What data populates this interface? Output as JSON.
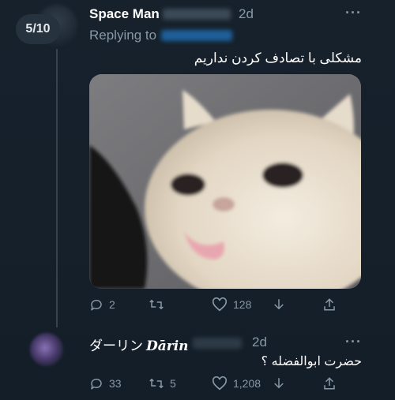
{
  "thread": {
    "page_indicator": "5/10",
    "tweet1": {
      "author_name": "Space Man",
      "time": "2d",
      "replying_to": "Replying to",
      "text": "مشکلی با تصادف کردن نداریم",
      "stats": {
        "replies": "2",
        "retweets": "",
        "likes": "128"
      }
    },
    "tweet2": {
      "author_name_jp": "ダーリン",
      "author_name_latin": "Dārin",
      "time": "2d",
      "text": "حضرت ابوالفضله ؟",
      "stats": {
        "replies": "33",
        "retweets": "5",
        "likes": "1,208"
      }
    },
    "more_menu": "···"
  },
  "icons": {
    "reply": "reply-icon",
    "retweet": "retweet-icon",
    "like": "heart-icon",
    "download": "download-icon",
    "share": "share-icon"
  },
  "colors": {
    "background": "#15202b",
    "muted_text": "#8899a6",
    "text": "#ffffff",
    "divider": "#38444d"
  }
}
